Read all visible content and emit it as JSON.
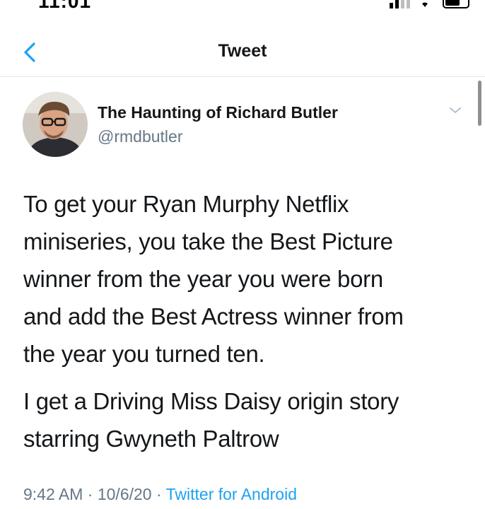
{
  "status_bar": {
    "time": "11:01"
  },
  "nav": {
    "back_icon": "chevron-left-icon",
    "title": "Tweet"
  },
  "author": {
    "display_name": "The Haunting of Richard Butler",
    "handle": "@rmdbutler",
    "avatar": "profile-photo",
    "menu_icon": "chevron-down-icon"
  },
  "tweet": {
    "paragraphs": [
      "To get your Ryan Murphy Netflix\nminiseries, you take the Best Picture\nwinner from the year you were born\nand add the Best Actress winner from\nthe year you turned ten.",
      "I get a Driving Miss Daisy origin story\nstarring Gwyneth Paltrow"
    ]
  },
  "meta": {
    "time": "9:42 AM",
    "date": "10/6/20",
    "separator": " · ",
    "source": "Twitter for Android"
  },
  "colors": {
    "accent": "#1da1f2",
    "text": "#14171a",
    "secondary": "#657786",
    "divider": "#e1e8ed"
  }
}
